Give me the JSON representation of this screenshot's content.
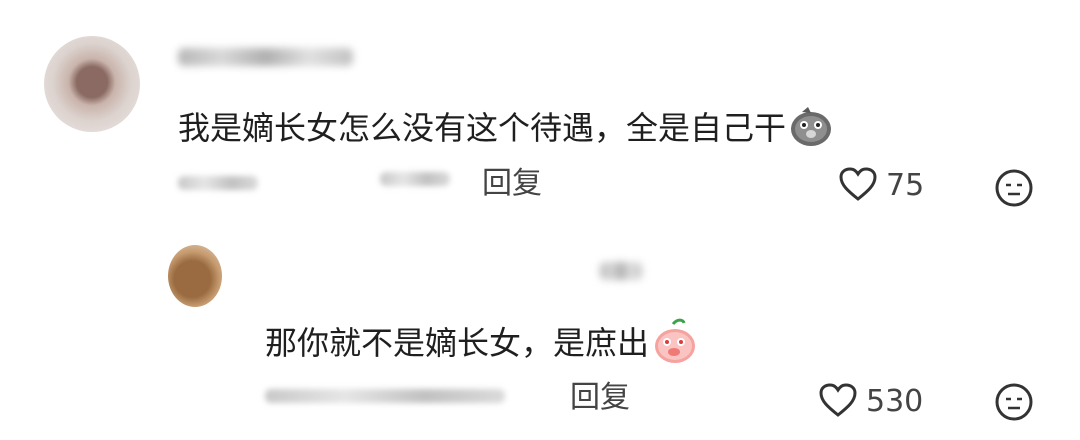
{
  "comments": [
    {
      "text": "我是嫡长女怎么没有这个待遇，全是自己干",
      "reply_label": "回复",
      "likes": "75",
      "emoji_icon": "pig-face-emoji",
      "replies": [
        {
          "text": "那你就不是嫡长女，是庶出",
          "reply_label": "回复",
          "likes": "530",
          "emoji_icon": "peach-covering-mouth-emoji"
        }
      ]
    }
  ]
}
